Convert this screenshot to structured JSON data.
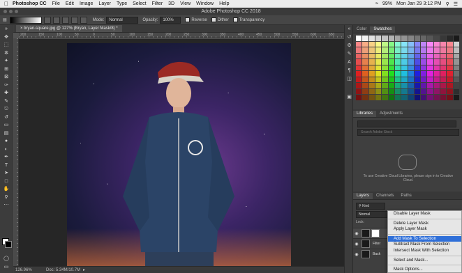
{
  "menubar": {
    "app_name": "Photoshop CC",
    "items": [
      "File",
      "Edit",
      "Image",
      "Layer",
      "Type",
      "Select",
      "Filter",
      "3D",
      "View",
      "Window",
      "Help"
    ],
    "battery": "99%",
    "datetime": "Mon Jan 29  3:12 PM"
  },
  "window": {
    "title": "Adobe Photoshop CC 2018"
  },
  "options": {
    "mode_label": "Mode:",
    "mode_value": "Normal",
    "opacity_label": "Opacity:",
    "opacity_value": "100%",
    "reverse_label": "Reverse",
    "dither_label": "Dither",
    "transparency_label": "Transparency"
  },
  "document": {
    "tab_title": "bryan-square.jpg @ 127% (Bryan, Layer Mask/8) *",
    "ruler_numbers": [
      "200",
      "150",
      "100",
      "50",
      "0",
      "50",
      "100",
      "150",
      "200",
      "250",
      "300",
      "350",
      "400",
      "450",
      "500",
      "550",
      "600",
      "650"
    ]
  },
  "statusbar": {
    "zoom": "126.96%",
    "doc_size": "Doc: 5.34M/10.7M"
  },
  "panels": {
    "color_tab": "Color",
    "swatches_tab": "Swatches",
    "libraries_tab": "Libraries",
    "adjustments_tab": "Adjustments",
    "library_search_placeholder": "Search Adobe Stock",
    "library_message": "To use Creative Cloud Libraries, please sign in to Creative Cloud.",
    "layers_tab": "Layers",
    "channels_tab": "Channels",
    "paths_tab": "Paths",
    "kind_label": "Kind",
    "blend_mode": "Normal",
    "lock_label": "Lock:",
    "layer_rows": [
      {
        "name": ""
      },
      {
        "name": "Filter"
      },
      {
        "name": "Back"
      }
    ]
  },
  "context_menu": {
    "items": [
      "Disable Layer Mask",
      "Delete Layer Mask",
      "Apply Layer Mask",
      "Add Mask To Selection",
      "Subtract Mask From Selection",
      "Intersect Mask With Selection",
      "Select and Mask...",
      "Mask Options..."
    ],
    "highlighted": "Add Mask To Selection"
  },
  "colors": {
    "accent_highlight": "#2f6fd8",
    "panel_bg": "#3f3f3f",
    "app_bg": "#535353"
  }
}
